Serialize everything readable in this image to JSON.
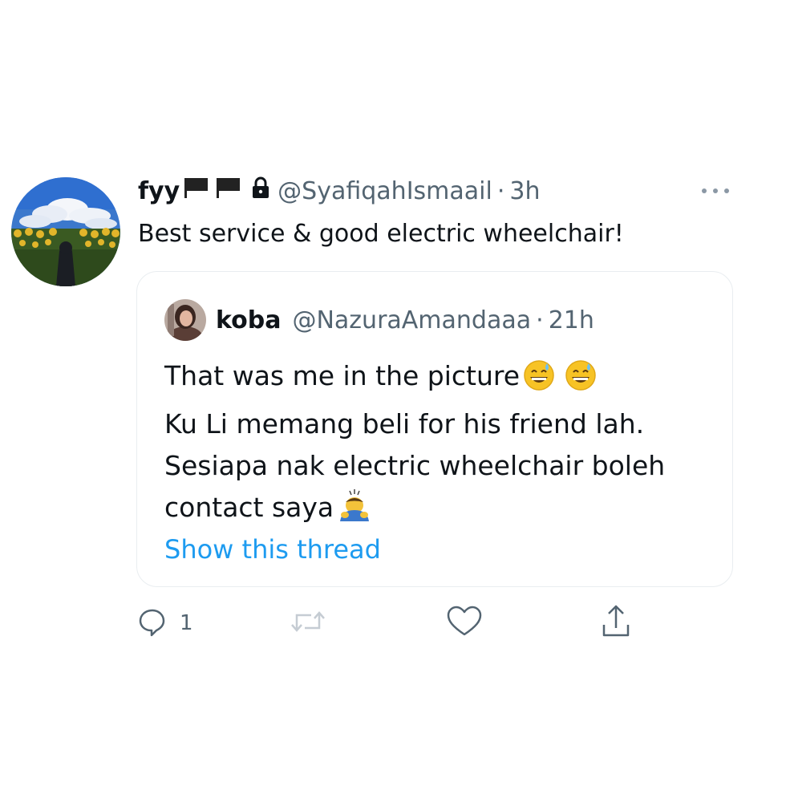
{
  "tweet": {
    "display_name": "fyy",
    "name_flags": [
      "black-flag",
      "black-flag"
    ],
    "verified_lock": "lock-icon",
    "handle": "@SyafiqahIsmaail",
    "separator": "·",
    "time": "3h",
    "text": "Best service & good electric wheelchair!"
  },
  "quote": {
    "display_name": "koba",
    "handle": "@NazuraAmandaaa",
    "separator": "·",
    "time": "21h",
    "lines": [
      "That was me in the picture",
      "Ku Li memang beli for his friend lah.",
      "Sesiapa nak electric wheelchair boleh",
      "contact saya"
    ],
    "emojis": [
      "grinning-sweat-emoji",
      "grinning-sweat-emoji",
      "bowing-person-emoji"
    ],
    "show_thread": "Show this thread"
  },
  "actions": {
    "reply_count": "1",
    "icons": [
      "reply-icon",
      "retweet-icon",
      "like-icon",
      "share-icon"
    ]
  },
  "colors": {
    "text": "#0f1419",
    "secondary": "#536471",
    "link": "#1d9bf0",
    "border": "#e9edf0"
  }
}
